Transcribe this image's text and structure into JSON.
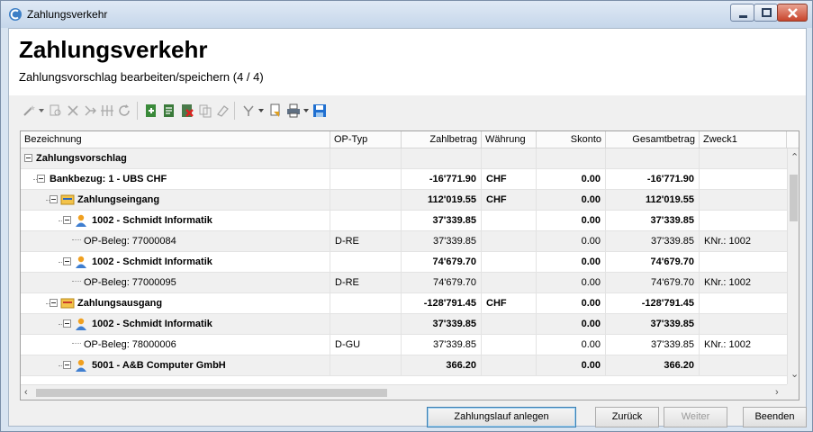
{
  "window": {
    "title": "Zahlungsverkehr"
  },
  "header": {
    "title": "Zahlungsverkehr",
    "subtitle": "Zahlungsvorschlag bearbeiten/speichern (4 / 4)"
  },
  "grid": {
    "columns": [
      "Bezeichnung",
      "OP-Typ",
      "Zahlbetrag",
      "Währung",
      "Skonto",
      "Gesamtbetrag",
      "Zweck1"
    ],
    "rows": [
      {
        "label": "Zahlungsvorschlag",
        "op_typ": "",
        "zahlbetrag": "",
        "waehrung": "",
        "skonto": "",
        "gesamtbetrag": "",
        "zweck1": ""
      },
      {
        "label": "Bankbezug: 1 - UBS CHF",
        "op_typ": "",
        "zahlbetrag": "-16'771.90",
        "waehrung": "CHF",
        "skonto": "0.00",
        "gesamtbetrag": "-16'771.90",
        "zweck1": ""
      },
      {
        "label": "Zahlungseingang",
        "op_typ": "",
        "zahlbetrag": "112'019.55",
        "waehrung": "CHF",
        "skonto": "0.00",
        "gesamtbetrag": "112'019.55",
        "zweck1": ""
      },
      {
        "label": "1002 - Schmidt Informatik",
        "op_typ": "",
        "zahlbetrag": "37'339.85",
        "waehrung": "",
        "skonto": "0.00",
        "gesamtbetrag": "37'339.85",
        "zweck1": ""
      },
      {
        "label": "OP-Beleg: 77000084",
        "op_typ": "D-RE",
        "zahlbetrag": "37'339.85",
        "waehrung": "",
        "skonto": "0.00",
        "gesamtbetrag": "37'339.85",
        "zweck1": "KNr.: 1002"
      },
      {
        "label": "1002 - Schmidt Informatik",
        "op_typ": "",
        "zahlbetrag": "74'679.70",
        "waehrung": "",
        "skonto": "0.00",
        "gesamtbetrag": "74'679.70",
        "zweck1": ""
      },
      {
        "label": "OP-Beleg: 77000095",
        "op_typ": "D-RE",
        "zahlbetrag": "74'679.70",
        "waehrung": "",
        "skonto": "0.00",
        "gesamtbetrag": "74'679.70",
        "zweck1": "KNr.: 1002"
      },
      {
        "label": "Zahlungsausgang",
        "op_typ": "",
        "zahlbetrag": "-128'791.45",
        "waehrung": "CHF",
        "skonto": "0.00",
        "gesamtbetrag": "-128'791.45",
        "zweck1": ""
      },
      {
        "label": "1002 - Schmidt Informatik",
        "op_typ": "",
        "zahlbetrag": "37'339.85",
        "waehrung": "",
        "skonto": "0.00",
        "gesamtbetrag": "37'339.85",
        "zweck1": ""
      },
      {
        "label": "OP-Beleg: 78000006",
        "op_typ": "D-GU",
        "zahlbetrag": "37'339.85",
        "waehrung": "",
        "skonto": "0.00",
        "gesamtbetrag": "37'339.85",
        "zweck1": "KNr.: 1002"
      },
      {
        "label": "5001 - A&B Computer GmbH",
        "op_typ": "",
        "zahlbetrag": "366.20",
        "waehrung": "",
        "skonto": "0.00",
        "gesamtbetrag": "366.20",
        "zweck1": ""
      }
    ]
  },
  "buttons": {
    "create_run": "Zahlungslauf anlegen",
    "back": "Zurück",
    "next": "Weiter",
    "finish": "Beenden"
  }
}
